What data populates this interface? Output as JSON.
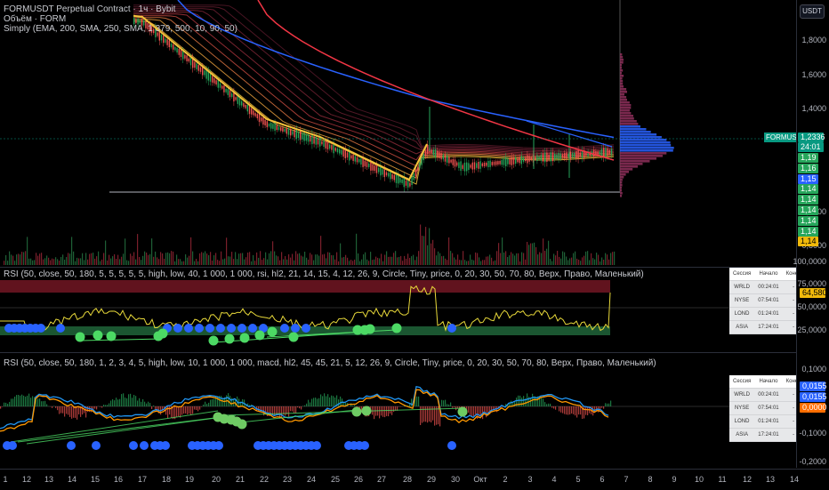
{
  "header": {
    "title": "FORMUSDT Perpetual Contract · 1ч · Bybit",
    "volume_label": "Объём · FORM",
    "simply_label": "Simply (EMA, 200, SMA, 250, SMA, 1 379, 500, 10, 90, 50)",
    "currency_button": "USDT"
  },
  "main_axis": [
    "1,8000",
    "1,6000",
    "1,4000",
    "1,0000",
    "0,8000",
    "100,0000"
  ],
  "current_price": {
    "symbol_label": "FORMUSDT.P",
    "price": "1,2336",
    "countdown": "24:01"
  },
  "price_tags": [
    {
      "text": "1,19",
      "color": "#26a65b"
    },
    {
      "text": "1,16",
      "color": "#26a65b"
    },
    {
      "text": "1,15",
      "color": "#2962ff"
    },
    {
      "text": "1,14",
      "color": "#26a65b"
    },
    {
      "text": "1,14",
      "color": "#26a65b"
    },
    {
      "text": "1,14",
      "color": "#26a65b"
    },
    {
      "text": "1,14",
      "color": "#26a65b"
    },
    {
      "text": "1,14",
      "color": "#26a65b"
    },
    {
      "text": "1,14",
      "color": "#f0b90b"
    }
  ],
  "rsi1": {
    "legend": "RSI (50, close, 50, 180, 5, 5, 5, 5, 5, high, low, 40, 1 000, 1 000, rsi, hl2, 21, 14, 15, 4, 12, 26, 9, Circle, Tiny, price, 0, 20, 30, 50, 70, 80, Верх, Право, Маленький)",
    "axis": [
      "75,0000",
      "50,0000",
      "25,0000"
    ],
    "value_tag": "64,5804"
  },
  "rsi2": {
    "legend": "RSI (50, close, 50, 180, 1, 2, 3, 4, 5, high, low, 10, 1 000, 1 000, macd, hl2, 45, 45, 21, 5, 12, 26, 9, Circle, Tiny, price, 0, 20, 30, 50, 70, 80, Верх, Право, Маленький)",
    "axis": [
      "0,1000",
      "-0,1000",
      "-0,2000"
    ],
    "value_tags": [
      {
        "text": "0,0155",
        "color": "#2962ff"
      },
      {
        "text": "0,0155",
        "color": "#2962ff"
      },
      {
        "text": "0,0000",
        "color": "#ff6d00"
      }
    ]
  },
  "session_table": {
    "headers": [
      "Сессия",
      "Начало",
      "Конец"
    ],
    "rows": [
      [
        "WRLD",
        "00:24:01",
        "-"
      ],
      [
        "NYSE",
        "07:54:01",
        "-"
      ],
      [
        "LOND",
        "01:24:01",
        "-"
      ],
      [
        "ASIA",
        "17:24:01",
        "-"
      ]
    ]
  },
  "time_axis": [
    "1",
    "12",
    "13",
    "14",
    "15",
    "16",
    "17",
    "18",
    "19",
    "20",
    "21",
    "22",
    "23",
    "24",
    "25",
    "26",
    "27",
    "28",
    "29",
    "30",
    "Окт",
    "2",
    "3",
    "4",
    "5",
    "6",
    "7",
    "8",
    "9",
    "10",
    "11",
    "12",
    "13",
    "14"
  ],
  "colors": {
    "rsi_line": "#e8d93a",
    "bull": "#26a65b",
    "bear": "#ef5350",
    "ema_blue": "#2962ff",
    "sma_red": "#f23645"
  }
}
